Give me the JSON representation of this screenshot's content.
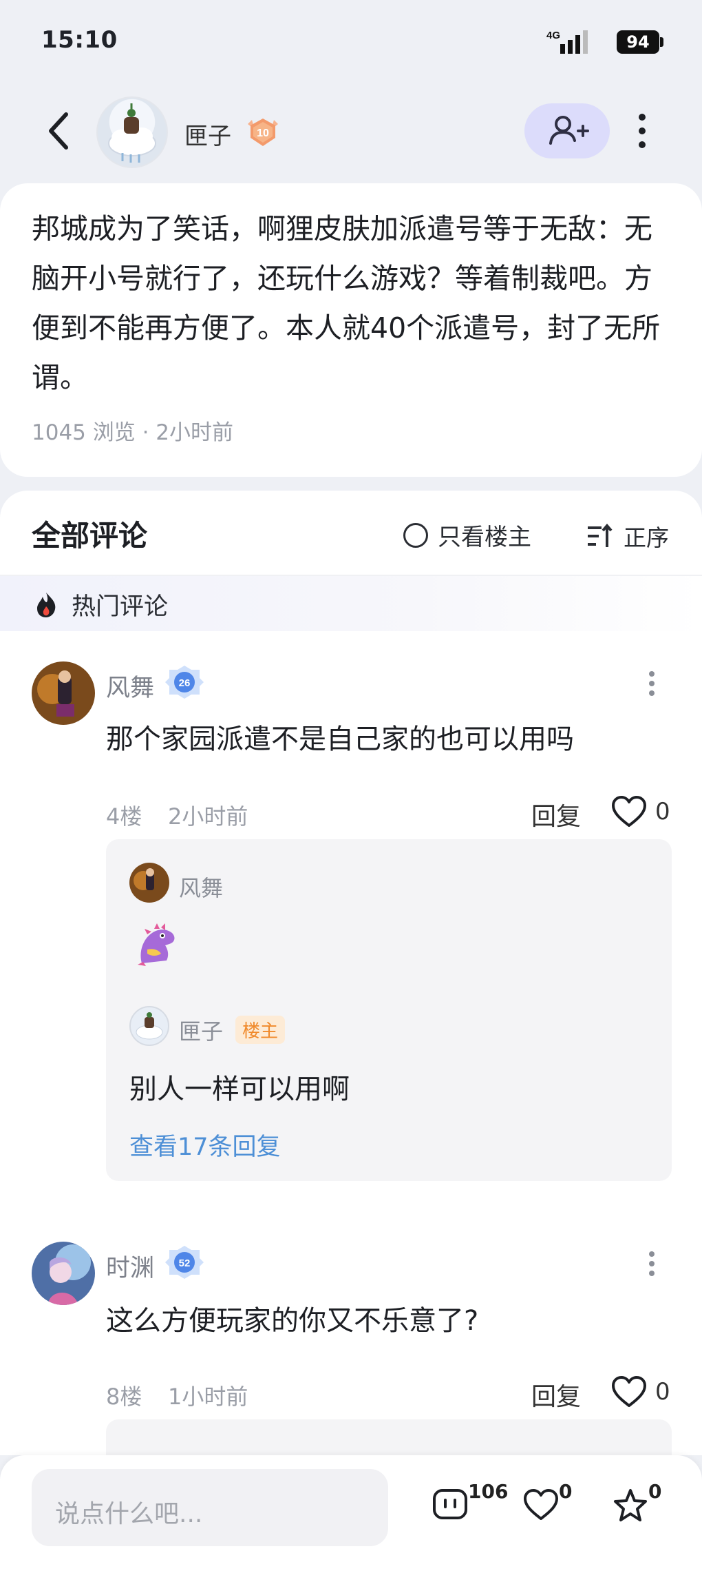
{
  "status_bar": {
    "time": "15:10",
    "network": "4G",
    "battery": "94"
  },
  "header": {
    "author": "匣子",
    "level": "10"
  },
  "post": {
    "text": "邦城成为了笑话，啊狸皮肤加派遣号等于无敌：无脑开小号就行了，还玩什么游戏？等着制裁吧。方便到不能再方便了。本人就40个派遣号，封了无所谓。",
    "meta": "1045 浏览 · 2小时前"
  },
  "comments_header": {
    "title": "全部评论",
    "op_only": "只看楼主",
    "sort": "正序"
  },
  "hot": {
    "label": "热门评论"
  },
  "comments": [
    {
      "name": "风舞",
      "level": "26",
      "text": "那个家园派遣不是自己家的也可以用吗",
      "floor": "4楼",
      "time": "2小时前",
      "reply": "回复",
      "likes": "0",
      "replies": [
        {
          "name": "风舞"
        },
        {
          "name": "匣子",
          "tag": "楼主",
          "text": "别人一样可以用啊"
        }
      ],
      "more_replies": "查看17条回复"
    },
    {
      "name": "时渊",
      "level": "52",
      "text": "这么方便玩家的你又不乐意了?",
      "floor": "8楼",
      "time": "1小时前",
      "reply": "回复",
      "likes": "0"
    }
  ],
  "bottom_bar": {
    "placeholder": "说点什么吧...",
    "comment_count": "106",
    "like_count": "0",
    "fav_count": "0"
  }
}
